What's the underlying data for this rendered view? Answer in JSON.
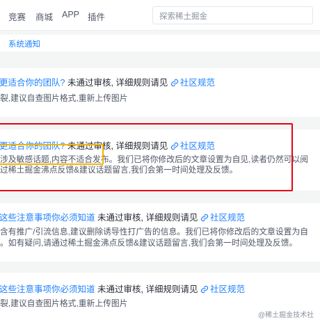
{
  "nav": {
    "items": [
      "竞赛",
      "商城",
      "APP",
      "插件"
    ],
    "search_placeholder": "探索稀土掘金"
  },
  "subtab": "系统通知",
  "notifications": [
    {
      "title": "更适合你的团队?",
      "status": "未通过审核,",
      "rule_text": "详细规则请见",
      "link": "社区规范",
      "lines": [
        "裂,建议自查图片格式,重新上传图片"
      ]
    },
    {
      "title": "更适合你的团队?",
      "status": "未通过审核,",
      "rule_text": "详细规则请见",
      "link": "社区规范",
      "lines": [
        "涉及敏感话题,内容不适合发布。我们已将你修改后的文章设置为自见,读者仍然可以阅",
        "过稀土掘金沸点反馈&建议话题留言,我们会第一时间处理及反馈。"
      ]
    },
    {
      "title": "这些注意事项你必须知道",
      "status": "未通过审核,",
      "rule_text": "详细规则请见",
      "link": "社区规范",
      "lines": [
        "含有推广/引流信息,建议删除诱导性打广告的信息。我们已将你修改后的文章设置为自",
        "。如有疑问,请通过稀土掘金沸点反馈&建议话题留言,我们会第一时间处理及反馈。"
      ]
    },
    {
      "title": "这些注意事项你必须知道",
      "status": "未通过审核,",
      "rule_text": "详细规则请见",
      "link": "社区规范",
      "lines": [
        "裂,建议自查图片格式,重新上传图片"
      ]
    }
  ],
  "watermark": "@稀土掘金技术社区",
  "colors": {
    "accent": "#1e80ff",
    "highlight_red": "#e60012",
    "highlight_yellow": "#f5b400"
  }
}
